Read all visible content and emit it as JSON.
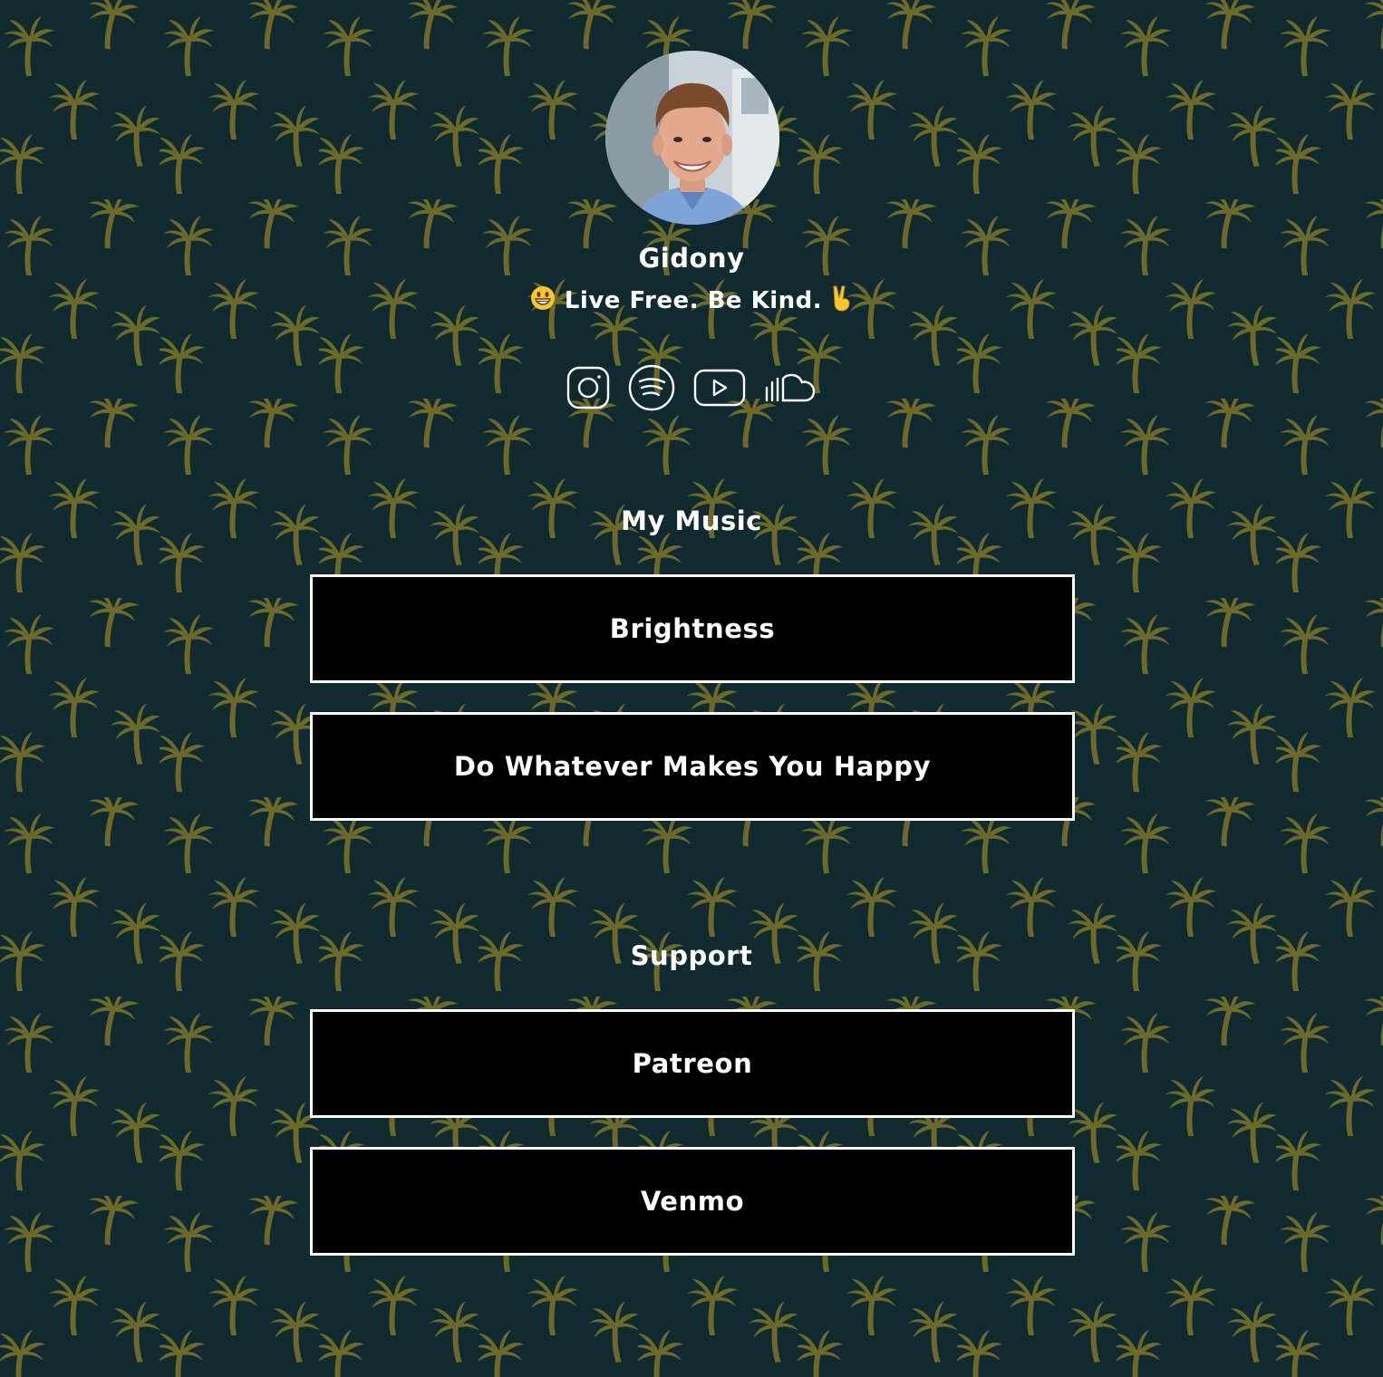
{
  "theme": {
    "background": "#112a30",
    "pattern_color": "#6b6a2a",
    "button_background": "#000000",
    "button_border": "#ffffff",
    "text_color": "#ffffff",
    "pattern_icon": "palm-tree-icon"
  },
  "profile": {
    "name": "Gidony",
    "bio_text": "Live Free. Be Kind.",
    "bio_leading_emoji": "grinning-face-emoji",
    "bio_trailing_emoji": "victory-hand-emoji",
    "avatar": "profile-photo"
  },
  "socials": [
    {
      "icon": "instagram-icon"
    },
    {
      "icon": "spotify-icon"
    },
    {
      "icon": "youtube-icon"
    },
    {
      "icon": "soundcloud-icon"
    }
  ],
  "sections": {
    "music": {
      "title": "My Music",
      "links": [
        "Brightness",
        "Do Whatever Makes You Happy"
      ]
    },
    "support": {
      "title": "Support",
      "links": [
        "Patreon",
        "Venmo"
      ]
    }
  }
}
